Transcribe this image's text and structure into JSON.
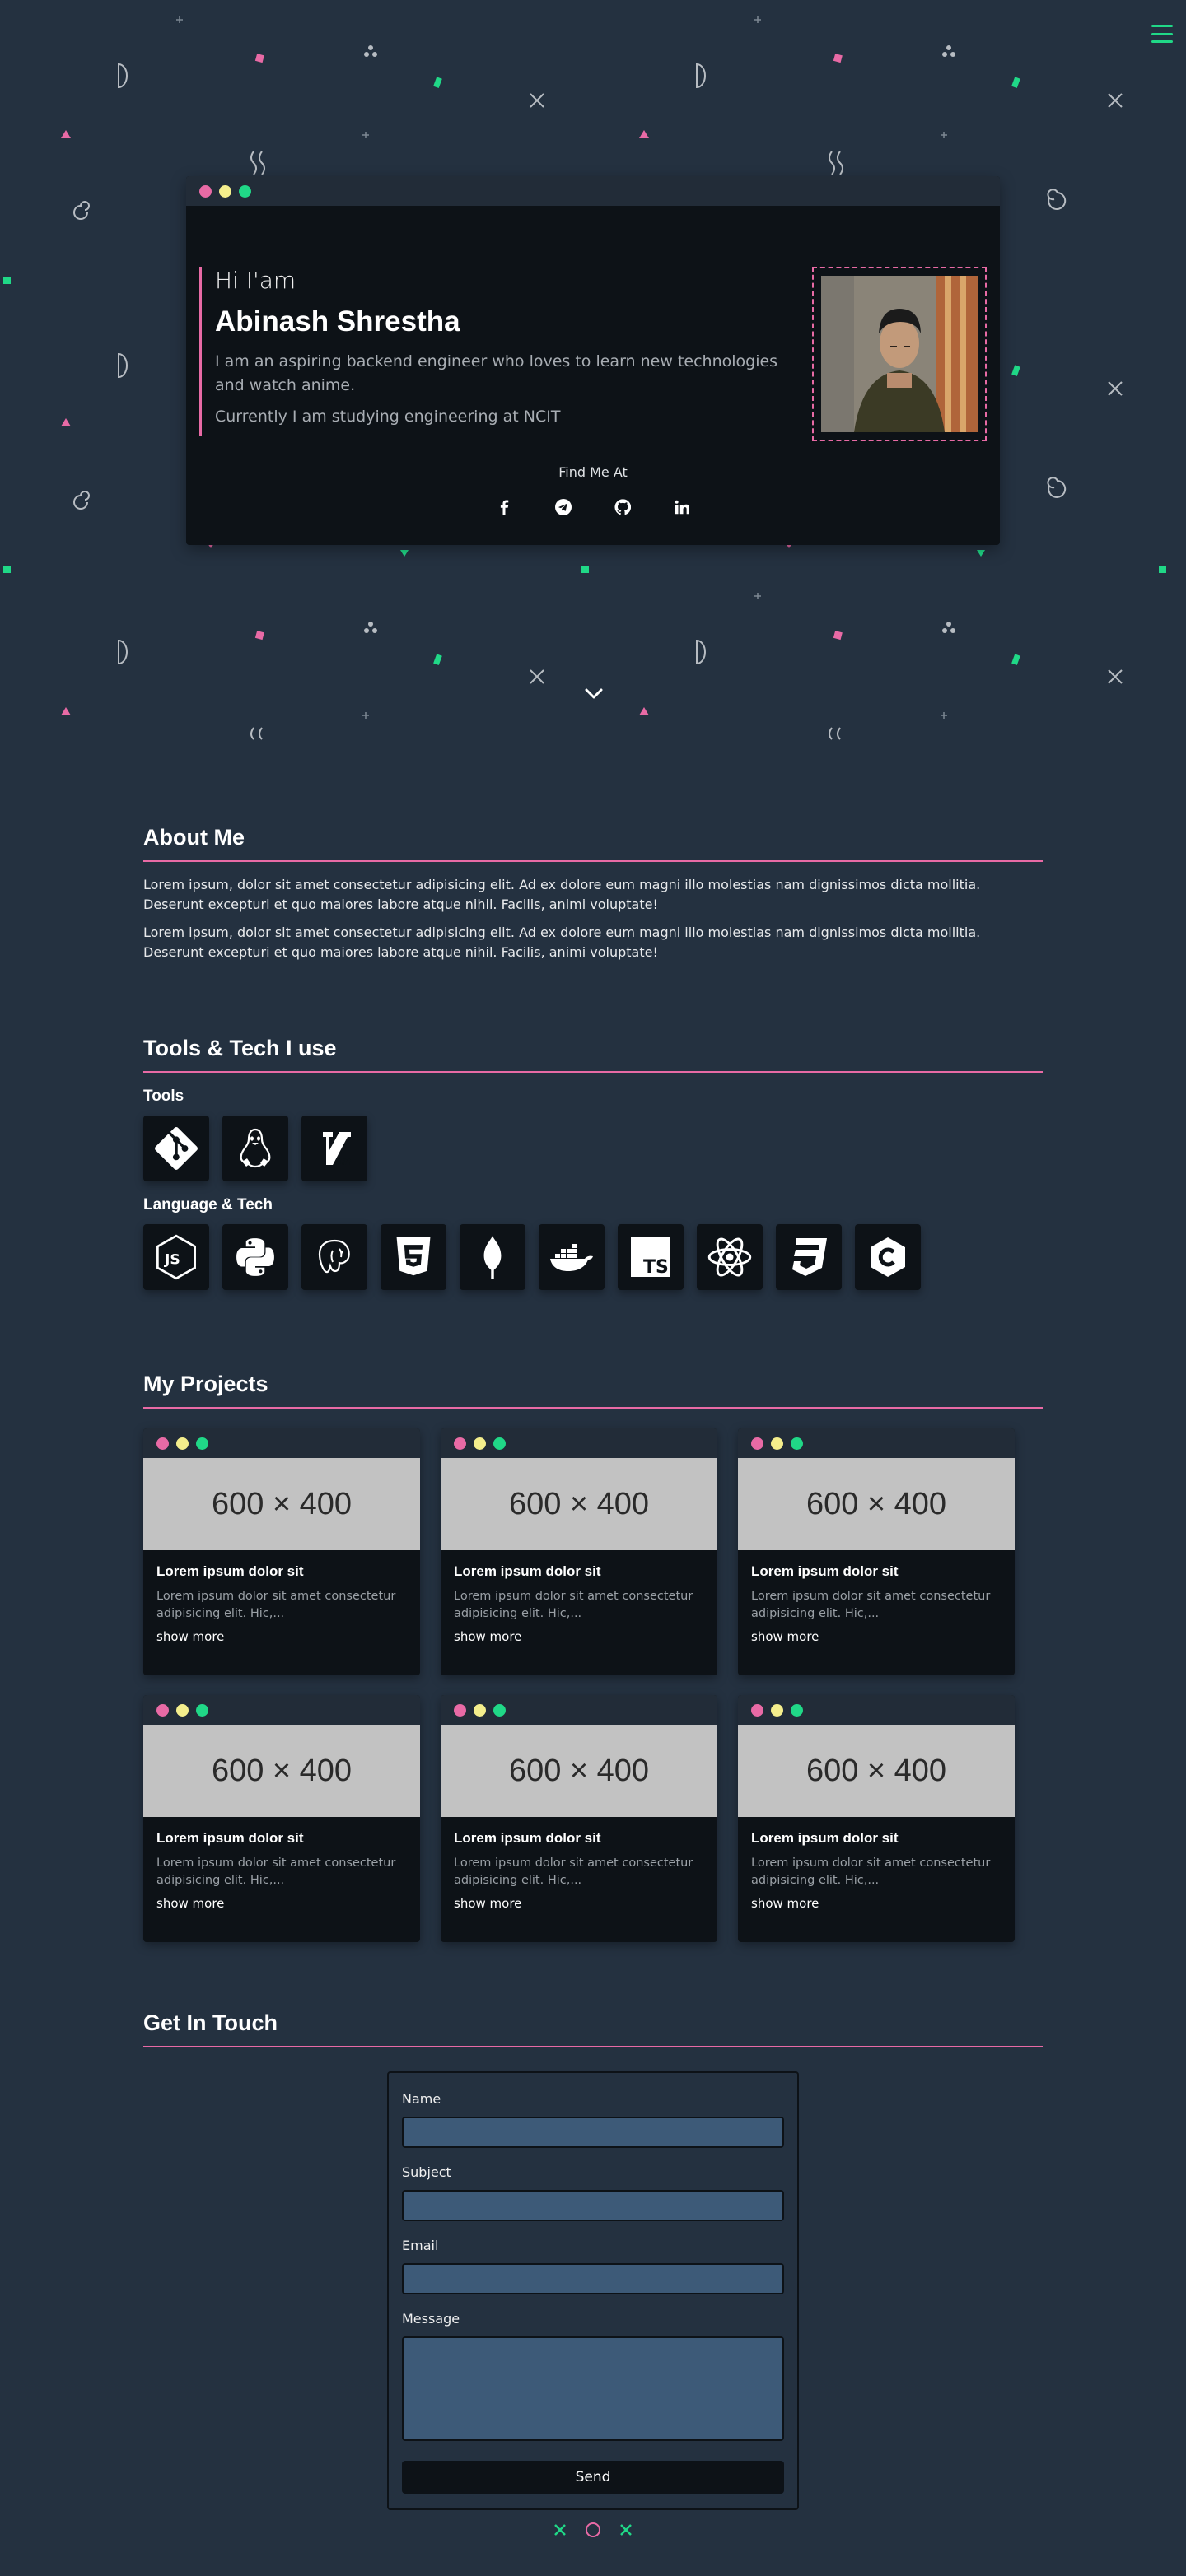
{
  "colors": {
    "background": "#243140",
    "panel": "#0d1217",
    "accent_pink": "#e86aa5",
    "accent_green": "#20d887",
    "accent_yellow": "#f4ee8c",
    "input_fill": "#3d5a78"
  },
  "nav": {
    "menu_icon": "hamburger-icon"
  },
  "hero": {
    "greeting": "Hi I'am",
    "name": "Abinash Shrestha",
    "description": "I am an aspiring backend engineer who loves to learn new technologies and watch anime.",
    "study": "Currently I am studying engineering at NCIT",
    "find_me": "Find Me At",
    "socials": [
      "facebook-icon",
      "telegram-icon",
      "github-icon",
      "linkedin-icon"
    ],
    "scroll_icon": "chevron-down-icon"
  },
  "about": {
    "title": "About Me",
    "paragraphs": [
      "Lorem ipsum, dolor sit amet consectetur adipisicing elit. Ad ex dolore eum magni illo molestias nam dignissimos dicta mollitia. Deserunt excepturi et quo maiores labore atque nihil. Facilis, animi voluptate!",
      "Lorem ipsum, dolor sit amet consectetur adipisicing elit. Ad ex dolore eum magni illo molestias nam dignissimos dicta mollitia. Deserunt excepturi et quo maiores labore atque nihil. Facilis, animi voluptate!"
    ]
  },
  "tools": {
    "title": "Tools & Tech I use",
    "tools_label": "Tools",
    "tools_icons": [
      "git-icon",
      "linux-icon",
      "vim-icon"
    ],
    "lang_label": "Language & Tech",
    "lang_icons": [
      "nodejs-icon",
      "python-icon",
      "postgresql-icon",
      "html5-icon",
      "mongodb-icon",
      "docker-icon",
      "typescript-icon",
      "react-icon",
      "css3-icon",
      "c-icon"
    ]
  },
  "projects": {
    "title": "My Projects",
    "items": [
      {
        "image": "600 × 400",
        "title": "Lorem ipsum dolor sit",
        "desc": "Lorem ipsum dolor sit amet consectetur adipisicing elit. Hic,...",
        "more": "show more"
      },
      {
        "image": "600 × 400",
        "title": "Lorem ipsum dolor sit",
        "desc": "Lorem ipsum dolor sit amet consectetur adipisicing elit. Hic,...",
        "more": "show more"
      },
      {
        "image": "600 × 400",
        "title": "Lorem ipsum dolor sit",
        "desc": "Lorem ipsum dolor sit amet consectetur adipisicing elit. Hic,...",
        "more": "show more"
      },
      {
        "image": "600 × 400",
        "title": "Lorem ipsum dolor sit",
        "desc": "Lorem ipsum dolor sit amet consectetur adipisicing elit. Hic,...",
        "more": "show more"
      },
      {
        "image": "600 × 400",
        "title": "Lorem ipsum dolor sit",
        "desc": "Lorem ipsum dolor sit amet consectetur adipisicing elit. Hic,...",
        "more": "show more"
      },
      {
        "image": "600 × 400",
        "title": "Lorem ipsum dolor sit",
        "desc": "Lorem ipsum dolor sit amet consectetur adipisicing elit. Hic,...",
        "more": "show more"
      }
    ]
  },
  "contact": {
    "title": "Get In Touch",
    "name_label": "Name",
    "name_value": "",
    "subject_label": "Subject",
    "subject_value": "",
    "email_label": "Email",
    "email_value": "",
    "message_label": "Message",
    "message_value": "",
    "send_label": "Send"
  },
  "footer": {
    "shapes": [
      "cross-icon",
      "circle-icon",
      "cross-icon"
    ]
  }
}
